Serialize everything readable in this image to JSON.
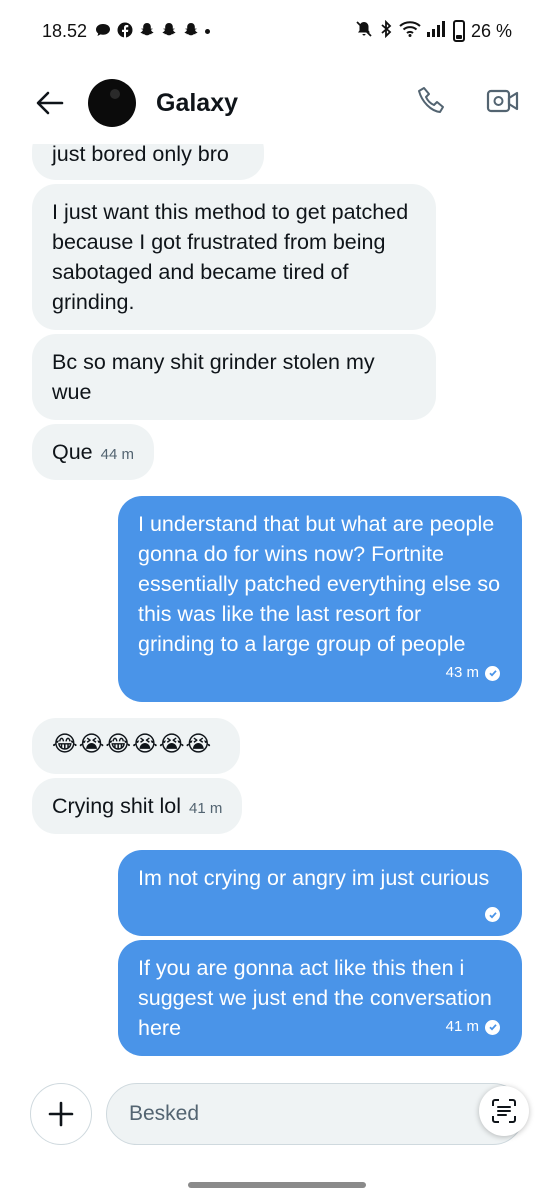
{
  "status_bar": {
    "time": "18.52",
    "battery": "26 %"
  },
  "header": {
    "contact_name": "Galaxy",
    "icons": [
      "back-arrow-icon",
      "phone-icon",
      "video-call-icon"
    ]
  },
  "messages": [
    {
      "direction": "in",
      "text": "just bored only bro"
    },
    {
      "direction": "in",
      "text": "I just want this method to get patched because I got frustrated from being sabotaged and became tired of grinding."
    },
    {
      "direction": "in",
      "text": "Bc so many shit grinder stolen my wue"
    },
    {
      "direction": "in",
      "text": "Que",
      "time": "44 m"
    },
    {
      "direction": "out",
      "text": "I understand that but what are people gonna do for wins now? Fortnite essentially patched everything else so this was like the last resort for grinding to a large group of people",
      "time": "43 m"
    },
    {
      "direction": "in",
      "text": "😂😭😂😭😭😭"
    },
    {
      "direction": "in",
      "text": "Crying shit lol",
      "time": "41 m"
    },
    {
      "direction": "out",
      "text": "Im not crying or angry im just curious",
      "time": ""
    },
    {
      "direction": "out",
      "text": "If you are gonna act like this then i suggest we just end the conversation here",
      "time": "41 m"
    }
  ],
  "composer": {
    "placeholder": "Besked"
  }
}
